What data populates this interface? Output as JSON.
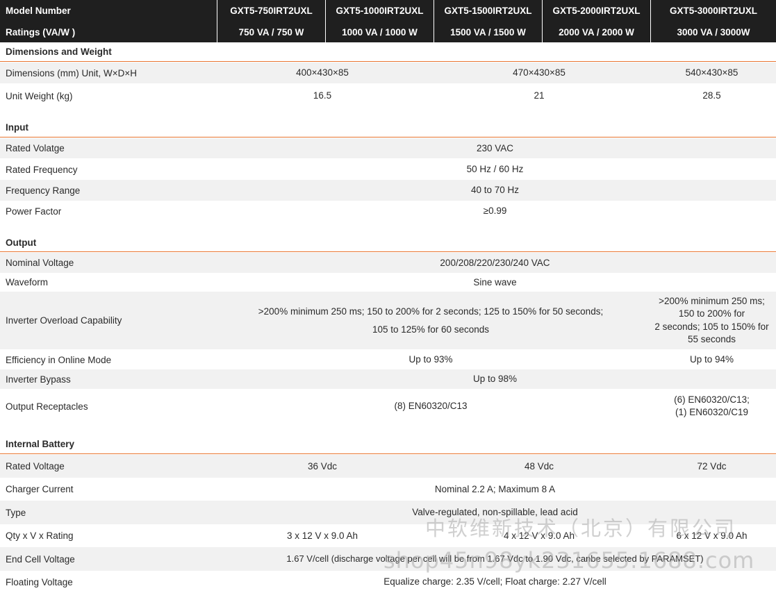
{
  "header": {
    "label1": "Model Number",
    "models": [
      "GXT5-750IRT2UXL",
      "GXT5-1000IRT2UXL",
      "GXT5-1500IRT2UXL",
      "GXT5-2000IRT2UXL",
      "GXT5-3000IRT2UXL"
    ],
    "label2": "Ratings (VA/W )",
    "ratings": [
      "750 VA / 750 W",
      "1000 VA / 1000 W",
      "1500 VA / 1500 W",
      "2000 VA / 2000 W",
      "3000 VA / 3000W"
    ]
  },
  "dimensions": {
    "title": "Dimensions and Weight",
    "dim_label": "Dimensions (mm) Unit, W×D×H",
    "dim_values": [
      "400×430×85",
      "470×430×85",
      "540×430×85"
    ],
    "weight_label": "Unit Weight (kg)",
    "weight_values": [
      "16.5",
      "21",
      "28.5"
    ]
  },
  "input": {
    "title": "Input",
    "rows": [
      {
        "label": "Rated Volatge",
        "value": "230 VAC"
      },
      {
        "label": "Rated Frequency",
        "value": "50 Hz / 60 Hz"
      },
      {
        "label": "Frequency Range",
        "value": "40 to 70 Hz"
      },
      {
        "label": "Power Factor",
        "value": "≥0.99"
      }
    ]
  },
  "output": {
    "title": "Output",
    "nominal_label": "Nominal Voltage",
    "nominal_value": "200/208/220/230/240 VAC",
    "waveform_label": "Waveform",
    "waveform_value": "Sine wave",
    "overload_label": "Inverter Overload Capability",
    "overload_main_line1": ">200% minimum 250 ms; 150 to 200% for 2 seconds; 125 to 150% for 50 seconds;",
    "overload_main_line2": "105 to 125% for 60 seconds",
    "overload_3000_line1": ">200% minimum 250 ms;",
    "overload_3000_line2": "150 to 200% for",
    "overload_3000_line3": "2 seconds; 105 to 150% for",
    "overload_3000_line4": "55 seconds",
    "efficiency_label": "Efficiency in Online Mode",
    "efficiency_main": "Up to 93%",
    "efficiency_3000": "Up to 94%",
    "bypass_label": "Inverter Bypass",
    "bypass_value": "Up to 98%",
    "receptacles_label": "Output Receptacles",
    "receptacles_main": "(8) EN60320/C13",
    "receptacles_3000_line1": "(6) EN60320/C13;",
    "receptacles_3000_line2": "(1) EN60320/C19"
  },
  "battery": {
    "title": "Internal Battery",
    "rated_label": "Rated Voltage",
    "rated_values": [
      "36 Vdc",
      "48 Vdc",
      "72 Vdc"
    ],
    "charger_label": "Charger Current",
    "charger_value": "Nominal 2.2 A; Maximum 8 A",
    "type_label": "Type",
    "type_value": "Valve-regulated, non-spillable, lead acid",
    "qty_label": "Qty x V x Rating",
    "qty_values": [
      "3 x 12 V x 9.0 Ah",
      "4 x 12 V x 9.0 Ah",
      "6 x 12 V x 9.0 Ah"
    ],
    "endcell_label": "End Cell Voltage",
    "endcell_value": "1.67 V/cell (discharge voltage per cell will be from 1.67 Vdc to 1.90 Vdc, canbe selected by PARAMSET)",
    "float_label": "Floating Voltage",
    "float_value": "Equalize charge: 2.35 V/cell; Float charge: 2.27 V/cell"
  },
  "watermark": {
    "line1": "中软维新技术（北京）有限公司",
    "line2": "shop45n98yk231655.1688.com"
  }
}
